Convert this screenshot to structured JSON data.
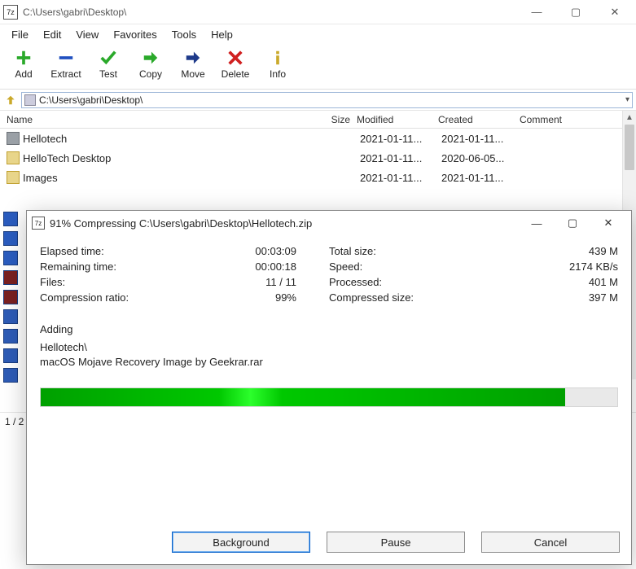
{
  "window": {
    "title": "C:\\Users\\gabri\\Desktop\\",
    "menus": [
      "File",
      "Edit",
      "View",
      "Favorites",
      "Tools",
      "Help"
    ],
    "toolbar": [
      {
        "label": "Add",
        "icon": "plus"
      },
      {
        "label": "Extract",
        "icon": "minus"
      },
      {
        "label": "Test",
        "icon": "check"
      },
      {
        "label": "Copy",
        "icon": "copy"
      },
      {
        "label": "Move",
        "icon": "move"
      },
      {
        "label": "Delete",
        "icon": "delete"
      },
      {
        "label": "Info",
        "icon": "info"
      }
    ],
    "path": "C:\\Users\\gabri\\Desktop\\",
    "columns": [
      "Name",
      "Size",
      "Modified",
      "Created",
      "Comment"
    ],
    "rows": [
      {
        "name": "Hellotech",
        "modified": "2021-01-11...",
        "created": "2021-01-11...",
        "type": "folder"
      },
      {
        "name": "HelloTech Desktop",
        "modified": "2021-01-11...",
        "created": "2020-06-05...",
        "type": "item"
      },
      {
        "name": "Images",
        "modified": "2021-01-11...",
        "created": "2021-01-11...",
        "type": "item"
      }
    ],
    "status": "1 / 2"
  },
  "dialog": {
    "title": "91% Compressing C:\\Users\\gabri\\Desktop\\Hellotech.zip",
    "left": {
      "elapsed_label": "Elapsed time:",
      "elapsed_value": "00:03:09",
      "remaining_label": "Remaining time:",
      "remaining_value": "00:00:18",
      "files_label": "Files:",
      "files_value": "11 / 11",
      "ratio_label": "Compression ratio:",
      "ratio_value": "99%"
    },
    "right": {
      "total_label": "Total size:",
      "total_value": "439 M",
      "speed_label": "Speed:",
      "speed_value": "2174 KB/s",
      "processed_label": "Processed:",
      "processed_value": "401 M",
      "compressed_label": "Compressed size:",
      "compressed_value": "397 M"
    },
    "adding_label": "Adding",
    "adding_line1": "Hellotech\\",
    "adding_line2": "macOS Mojave Recovery Image by Geekrar.rar",
    "progress_percent": 91,
    "buttons": {
      "background": "Background",
      "pause": "Pause",
      "cancel": "Cancel"
    }
  },
  "icons": {
    "plus_color": "#2aa92a",
    "minus_color": "#2050c0",
    "check_color": "#2aa92a",
    "copy_color": "#2aa92a",
    "move_color": "#1e3a8a",
    "delete_color": "#d02020",
    "info_color": "#caa92a"
  }
}
